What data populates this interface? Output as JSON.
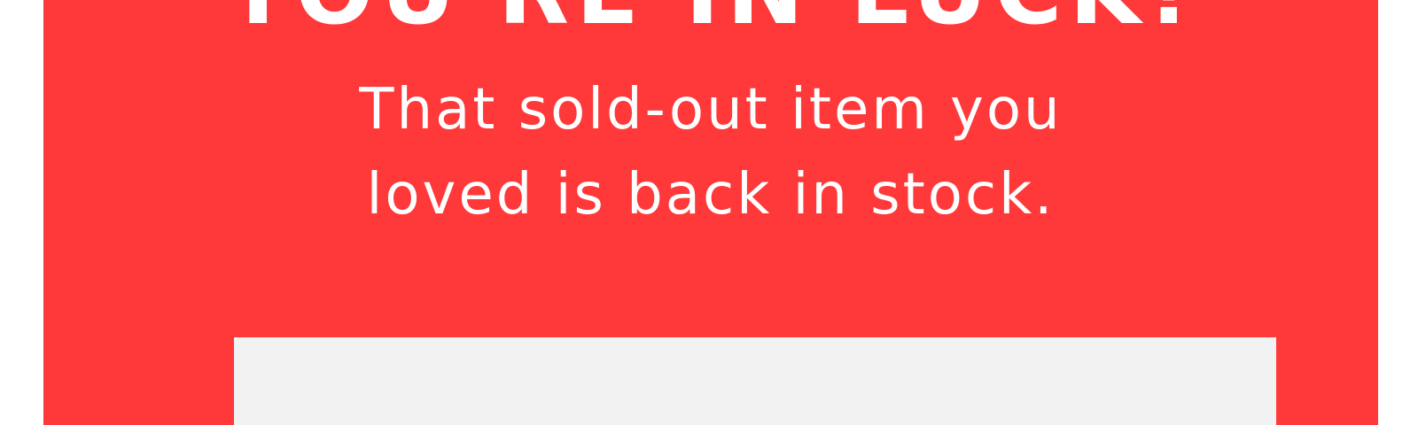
{
  "banner": {
    "headline": "YOU'RE IN LUCK!",
    "message_line_1": "That sold-out item you",
    "message_line_2": "loved is back in stock.",
    "background_color": "#ff3939",
    "text_color": "#ffffff"
  },
  "panel": {
    "background_color": "#f2f2f2"
  }
}
